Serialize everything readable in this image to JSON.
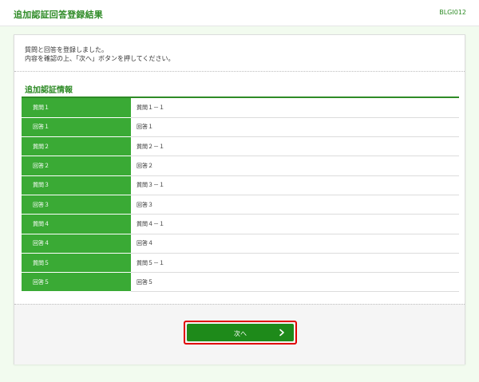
{
  "header": {
    "title": "追加認証回答登録結果",
    "screen_id": "BLGI012"
  },
  "message": {
    "line1": "質問と回答を登録しました。",
    "line2": "内容を確認の上、「次へ」ボタンを押してください。"
  },
  "section": {
    "title": "追加認証情報"
  },
  "rows": [
    {
      "label": "質問１",
      "value": "質問１－１"
    },
    {
      "label": "回答１",
      "value": "回答１"
    },
    {
      "label": "質問２",
      "value": "質問２－１"
    },
    {
      "label": "回答２",
      "value": "回答２"
    },
    {
      "label": "質問３",
      "value": "質問３－１"
    },
    {
      "label": "回答３",
      "value": "回答３"
    },
    {
      "label": "質問４",
      "value": "質問４－１"
    },
    {
      "label": "回答４",
      "value": "回答４"
    },
    {
      "label": "質問５",
      "value": "質問５－１"
    },
    {
      "label": "回答５",
      "value": "回答５"
    }
  ],
  "actions": {
    "next_label": "次へ",
    "next_icon": "chevron-right-icon"
  },
  "colors": {
    "brand_green": "#2e8b26",
    "label_cell_green": "#3aaa35",
    "button_green": "#1e8a1a",
    "highlight_red": "#e00000",
    "page_bg": "#f2fbef"
  }
}
